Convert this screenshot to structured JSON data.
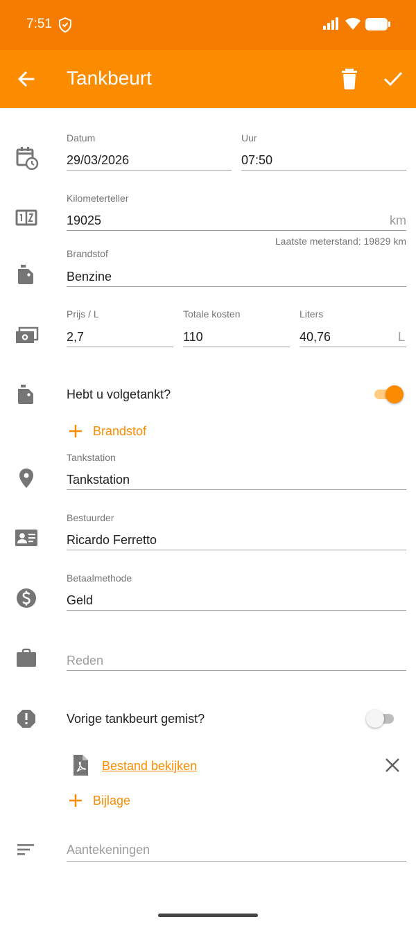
{
  "status_bar": {
    "time": "7:51"
  },
  "app_bar": {
    "title": "Tankbeurt"
  },
  "form": {
    "datum": {
      "label": "Datum",
      "value": "29/03/2026"
    },
    "uur": {
      "label": "Uur",
      "value": "07:50"
    },
    "kilometerteller": {
      "label": "Kilometerteller",
      "value": "19025",
      "unit": "km",
      "helper": "Laatste meterstand: 19829 km"
    },
    "brandstof": {
      "label": "Brandstof",
      "value": "Benzine"
    },
    "prijs": {
      "label": "Prijs / L",
      "value": "2,7"
    },
    "totale_kosten": {
      "label": "Totale kosten",
      "value": "110"
    },
    "liters": {
      "label": "Liters",
      "value": "40,76",
      "unit": "L"
    },
    "volgetankt": {
      "label": "Hebt u volgetankt?",
      "checked": true
    },
    "add_brandstof": {
      "label": "Brandstof"
    },
    "tankstation": {
      "label": "Tankstation",
      "value": "Tankstation"
    },
    "bestuurder": {
      "label": "Bestuurder",
      "value": "Ricardo Ferretto"
    },
    "betaalmethode": {
      "label": "Betaalmethode",
      "value": "Geld"
    },
    "reden": {
      "placeholder": "Reden"
    },
    "gemist": {
      "label": "Vorige tankbeurt gemist?",
      "checked": false
    },
    "bestand": {
      "label": "Bestand bekijken"
    },
    "add_bijlage": {
      "label": "Bijlage"
    },
    "aantekeningen": {
      "placeholder": "Aantekeningen"
    }
  },
  "colors": {
    "accent": "#fb8c00",
    "status_bar": "#f57c00",
    "icon": "#757575"
  }
}
